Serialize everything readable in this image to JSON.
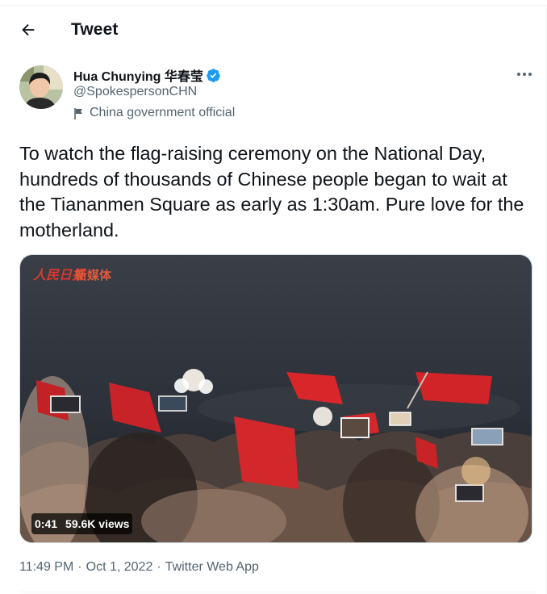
{
  "header": {
    "title": "Tweet",
    "back_icon": "arrow-left-icon"
  },
  "author": {
    "name": "Hua Chunying 华春莹",
    "handle": "@SpokespersonCHN",
    "verified_icon": "verified-badge-icon",
    "verified_color": "#1d9bf0",
    "affiliation": "China government official",
    "affiliation_icon": "flag-icon"
  },
  "more_icon": "more-horizontal-icon",
  "tweet": {
    "text": "To watch the flag-raising ceremony on the National Day, hundreds of thousands of Chinese people began to wait at the Tiananmen Square as early as 1:30am. Pure love for the motherland."
  },
  "media": {
    "watermark_logo": "人民日报",
    "watermark_text": "新媒体",
    "duration": "0:41",
    "views": "59.6K views"
  },
  "meta": {
    "time": "11:49 PM",
    "date": "Oct 1, 2022",
    "source": "Twitter Web App",
    "separator": "·"
  },
  "colors": {
    "secondary_text": "#536471",
    "primary_text": "#0f1419",
    "border": "#eff3f4"
  }
}
